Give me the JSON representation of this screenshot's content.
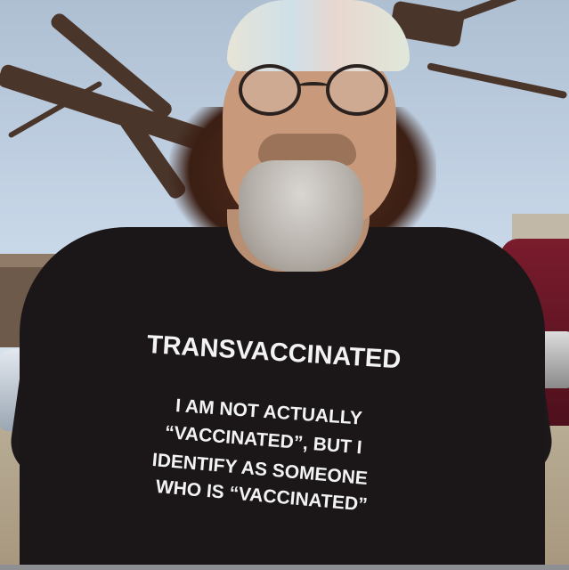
{
  "shirt": {
    "title": "TRANSVACCINATED",
    "lines": [
      "I AM NOT ACTUALLY",
      "“VACCINATED”, BUT I",
      "IDENTIFY AS SOMEONE",
      "WHO IS “VACCINATED”"
    ]
  },
  "colors": {
    "sky": "#c6d6e7",
    "shirt": "#1b1719",
    "text": "#f3f3f3",
    "truck": "#6a1626"
  }
}
